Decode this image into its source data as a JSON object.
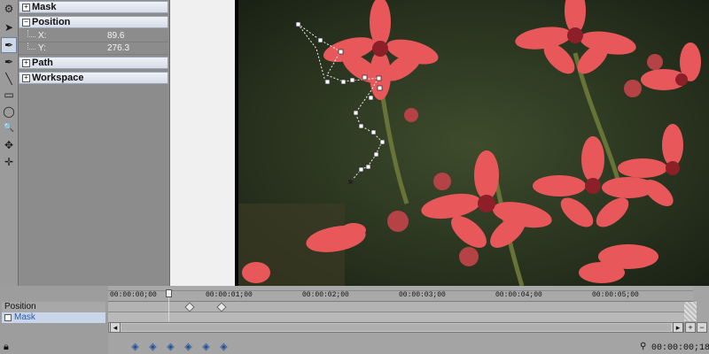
{
  "panel": {
    "sections": {
      "mask": "Mask",
      "position": "Position",
      "path": "Path",
      "workspace": "Workspace"
    },
    "position_props": [
      {
        "key": "X:",
        "value": "89.6"
      },
      {
        "key": "Y:",
        "value": "276.3"
      }
    ]
  },
  "tools": [
    {
      "icon": "gear-icon",
      "glyph": "⚙"
    },
    {
      "icon": "arrow-pointer-icon",
      "glyph": "➤"
    },
    {
      "icon": "pen-tool-icon",
      "glyph": "✒"
    },
    {
      "icon": "add-point-pen-icon",
      "glyph": "✒"
    },
    {
      "icon": "line-tool-icon",
      "glyph": "╲"
    },
    {
      "icon": "rectangle-tool-icon",
      "glyph": "▭"
    },
    {
      "icon": "ellipse-tool-icon",
      "glyph": "◯"
    },
    {
      "icon": "zoom-icon",
      "glyph": "🔍"
    },
    {
      "icon": "point-select-icon",
      "glyph": "✥"
    },
    {
      "icon": "move-icon",
      "glyph": "✛"
    }
  ],
  "timeline": {
    "tracks": [
      "Position",
      "Mask"
    ],
    "ruler_ticks": [
      "00:00:00;00",
      "00:00:01;00",
      "00:00:02;00",
      "00:00:03;00",
      "00:00:04;00",
      "00:00:05;00"
    ],
    "current_time": "00:00:00;18"
  },
  "colors": {
    "panel_bg": "#8c8c8c",
    "section_header": "#dfe4ee",
    "keyframe_button": "#1e4f9a"
  }
}
